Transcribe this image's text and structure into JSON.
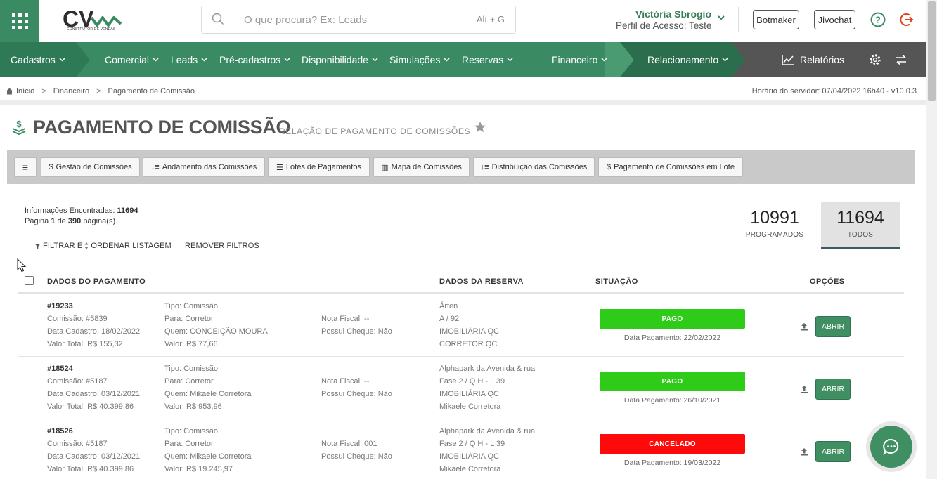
{
  "header": {
    "logo_text": "CV",
    "logo_subtitle": "CONSTRUTOR DE VENDAS",
    "search_placeholder": "O que procura? Ex: Leads",
    "search_shortcut": "Alt + G",
    "user_name": "Victória Sbrogio",
    "user_profile": "Perfil de Acesso: Teste",
    "botmaker_label": "Botmaker",
    "jivochat_label": "Jivochat"
  },
  "nav": {
    "items": [
      {
        "label": "Cadastros"
      },
      {
        "label": "Comercial"
      },
      {
        "label": "Leads"
      },
      {
        "label": "Pré-cadastros"
      },
      {
        "label": "Disponibilidade"
      },
      {
        "label": "Simulações"
      },
      {
        "label": "Reservas"
      },
      {
        "label": "Financeiro"
      },
      {
        "label": "Relacionamento"
      }
    ],
    "reports_label": "Relatórios"
  },
  "breadcrumb": {
    "items": [
      "Início",
      "Financeiro",
      "Pagamento de Comissão"
    ],
    "server_time": "Horário do servidor: 07/04/2022 16h40 - v10.0.3"
  },
  "page": {
    "title": "PAGAMENTO DE COMISSÃO",
    "subtitle": "RELAÇÃO DE PAGAMENTO DE COMISSÕES"
  },
  "toolbar": {
    "menu_icon": "≡",
    "buttons": [
      {
        "icon": "$",
        "label": "Gestão de Comissões"
      },
      {
        "icon": "↓≡",
        "label": "Andamento das Comissões"
      },
      {
        "icon": "☰",
        "label": "Lotes de Pagamentos"
      },
      {
        "icon": "▥",
        "label": "Mapa de Comissões"
      },
      {
        "icon": "↓≡",
        "label": "Distribuição das Comissões"
      },
      {
        "icon": "$",
        "label": "Pagamento de Comissões em Lote"
      }
    ]
  },
  "info": {
    "found_label": "Informações Encontradas:",
    "found_count": "11694",
    "page_label": "Página",
    "page_current": "1",
    "page_of": "de",
    "page_total": "390",
    "page_suffix": "página(s)."
  },
  "counters": [
    {
      "value": "10991",
      "label": "PROGRAMADOS"
    },
    {
      "value": "11694",
      "label": "TODOS"
    }
  ],
  "filters": {
    "filter_label": "FILTRAR E",
    "order_label": "ORDENAR LISTAGEM",
    "remove_label": "REMOVER FILTROS"
  },
  "table": {
    "headers": [
      "DADOS DO PAGAMENTO",
      "DADOS DA RESERVA",
      "SITUAÇÃO",
      "OPÇÕES"
    ],
    "open_label": "ABRIR",
    "rows": [
      {
        "id": "#19233",
        "commission": "Comissão: #5839",
        "created": "Data Cadastro: 18/02/2022",
        "total": "Valor Total: R$ 155,32",
        "type": "Tipo: Comissão",
        "to": "Para: Corretor",
        "who": "Quem: CONCEIÇÃO MOURA",
        "value": "Valor: R$ 77,66",
        "invoice": "Nota Fiscal: --",
        "cheque": "Possui Cheque: Não",
        "res1": "Árten",
        "res2": "A / 92",
        "res3": "IMOBILIÁRIA QC",
        "res4": "CORRETOR QC",
        "status": "PAGO",
        "status_color": "#2ecc18",
        "pay_date": "Data Pagamento: 22/02/2022"
      },
      {
        "id": "#18524",
        "commission": "Comissão: #5187",
        "created": "Data Cadastro: 03/12/2021",
        "total": "Valor Total: R$ 40.399,86",
        "type": "Tipo: Comissão",
        "to": "Para: Corretor",
        "who": "Quem: Mikaele Corretora",
        "value": "Valor: R$ 953,96",
        "invoice": "Nota Fiscal: --",
        "cheque": "Possui Cheque: Não",
        "res1": "Alphapark da Avenida & rua",
        "res2": "Fase 2 / Q H - L 39",
        "res3": "IMOBILIÁRIA QC",
        "res4": "Mikaele Corretora",
        "status": "PAGO",
        "status_color": "#2ecc18",
        "pay_date": "Data Pagamento: 26/10/2021"
      },
      {
        "id": "#18526",
        "commission": "Comissão: #5187",
        "created": "Data Cadastro: 03/12/2021",
        "total": "Valor Total: R$ 40.399,86",
        "type": "Tipo: Comissão",
        "to": "Para: Corretor",
        "who": "Quem: Mikaele Corretora",
        "value": "Valor: R$ 19.245,97",
        "invoice": "Nota Fiscal: 001",
        "cheque": "Possui Cheque: Não",
        "res1": "Alphapark da Avenida & rua",
        "res2": "Fase 2 / Q H - L 39",
        "res3": "IMOBILIÁRIA QC",
        "res4": "Mikaele Corretora",
        "status": "CANCELADO",
        "status_color": "#ff0a0a",
        "pay_date": "Data Pagamento: 19/03/2022"
      }
    ]
  },
  "colors": {
    "brand_green": "#3a8a64",
    "nav_dark": "#555555",
    "paid": "#2ecc18",
    "cancelled": "#ff0a0a"
  }
}
